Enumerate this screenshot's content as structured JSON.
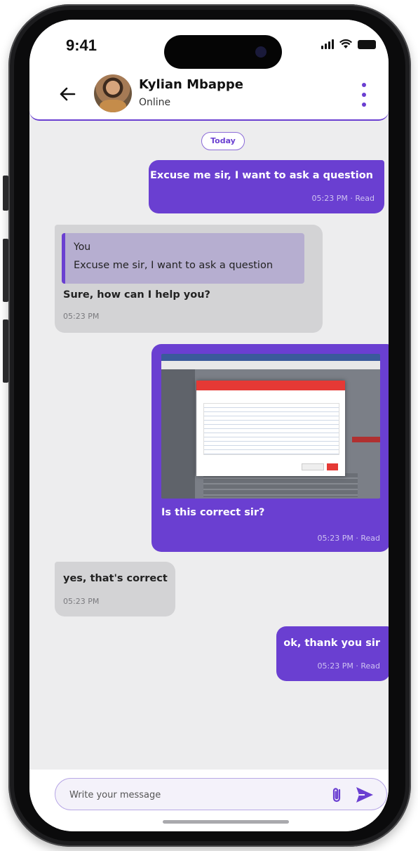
{
  "status_bar": {
    "time": "9:41"
  },
  "header": {
    "contact_name": "Kylian Mbappe",
    "contact_status": "Online"
  },
  "day_separator": "Today",
  "messages": [
    {
      "direction": "outgoing",
      "text": "Excuse me sir, I want to ask a question",
      "meta": "05:23 PM · Read"
    },
    {
      "direction": "incoming",
      "quote_author": "You",
      "quote_text": "Excuse me sir, I want to ask a question",
      "text": "Sure, how can I help you?",
      "meta": "05:23 PM"
    },
    {
      "direction": "outgoing",
      "attachment": "screenshot-image",
      "text": "Is this correct sir?",
      "meta": "05:23 PM · Read"
    },
    {
      "direction": "incoming",
      "text": "yes, that's correct",
      "meta": "05:23 PM"
    },
    {
      "direction": "outgoing",
      "text": "ok, thank you sir",
      "meta": "05:23 PM · Read"
    }
  ],
  "composer": {
    "placeholder": "Write your message",
    "value": ""
  },
  "colors": {
    "accent": "#6a3fd1",
    "incoming_bubble": "#d3d3d5",
    "quote_background": "#b6aed0",
    "chat_background": "#ededee"
  },
  "icons": {
    "back": "arrow-left-icon",
    "more": "more-vertical-icon",
    "attach": "paperclip-icon",
    "send": "send-icon"
  }
}
